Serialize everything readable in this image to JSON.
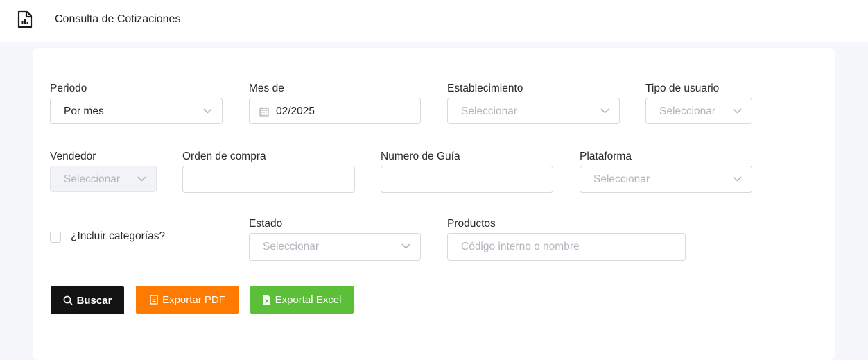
{
  "header": {
    "title": "Consulta de Cotizaciones",
    "icon": "report-file-icon"
  },
  "filters": {
    "periodo": {
      "label": "Periodo",
      "value": "Por mes"
    },
    "mes": {
      "label": "Mes de",
      "value": "02/2025"
    },
    "establecimiento": {
      "label": "Establecimiento",
      "placeholder": "Seleccionar"
    },
    "tipo_usuario": {
      "label": "Tipo de usuario",
      "placeholder": "Seleccionar"
    },
    "vendedor": {
      "label": "Vendedor",
      "placeholder": "Seleccionar"
    },
    "orden_compra": {
      "label": "Orden de compra",
      "value": ""
    },
    "numero_guia": {
      "label": "Numero de Guía",
      "value": ""
    },
    "plataforma": {
      "label": "Plataforma",
      "placeholder": "Seleccionar"
    },
    "incluir_categorias": {
      "label": "¿Incluir categorías?",
      "checked": false
    },
    "estado": {
      "label": "Estado",
      "placeholder": "Seleccionar"
    },
    "productos": {
      "label": "Productos",
      "placeholder": "Código interno o nombre"
    }
  },
  "buttons": {
    "search": "Buscar",
    "pdf": "Exportar PDF",
    "excel": "Exportal Excel"
  },
  "colors": {
    "search_button": "#131313",
    "pdf_button": "#ff7a00",
    "excel_button": "#5cbf3a",
    "page_background": "#f6f7fa"
  }
}
